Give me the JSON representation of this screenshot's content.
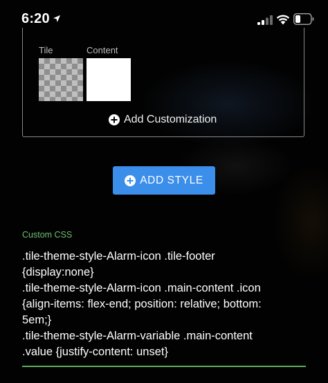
{
  "status_bar": {
    "time": "6:20",
    "icons": [
      "location-arrow-icon",
      "cellular-signal-icon",
      "wifi-icon",
      "battery-icon"
    ]
  },
  "customization": {
    "tile_label": "Tile",
    "content_label": "Content",
    "add_customization_label": "Add Customization"
  },
  "add_style": {
    "label": "ADD STYLE"
  },
  "custom_css": {
    "label": "Custom CSS",
    "value": ".tile-theme-style-Alarm-icon .tile-footer\n{display:none}\n.tile-theme-style-Alarm-icon .main-content .icon\n{align-items: flex-end; position: relative; bottom:\n5em;}\n.tile-theme-style-Alarm-variable .main-content\n.value {justify-content: unset}"
  },
  "colors": {
    "accent_blue": "#3b8eea",
    "label_green": "#6fbf73",
    "background": "#020202"
  }
}
